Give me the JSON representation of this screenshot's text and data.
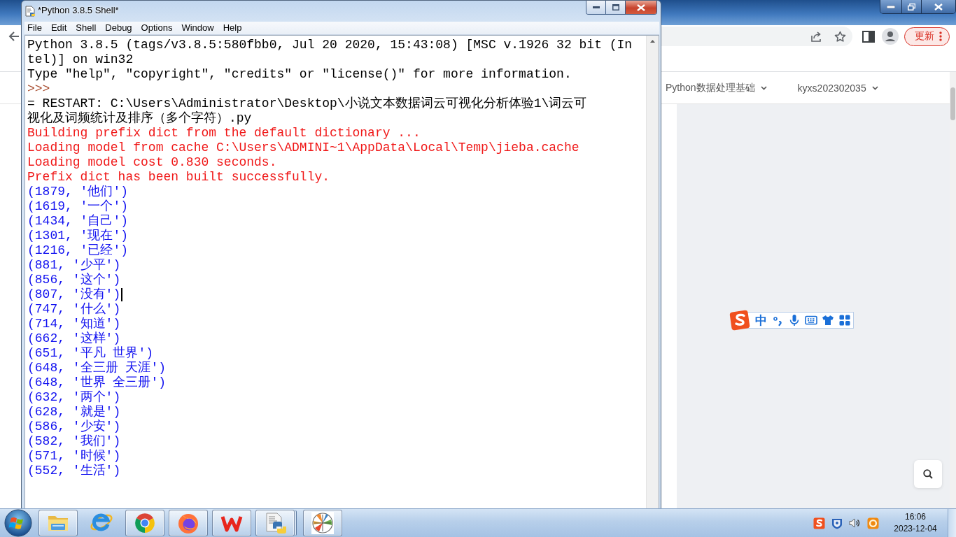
{
  "browser": {
    "update_button": "更新",
    "nav_items": [
      {
        "label": "Python数据处理基础"
      },
      {
        "label": "kyxs202302035"
      }
    ]
  },
  "shell_window": {
    "title": "*Python 3.8.5 Shell*",
    "menu": [
      "File",
      "Edit",
      "Shell",
      "Debug",
      "Options",
      "Window",
      "Help"
    ],
    "lines": [
      {
        "kind": "banner",
        "text": "Python 3.8.5 (tags/v3.8.5:580fbb0, Jul 20 2020, 15:43:08) [MSC v.1926 32 bit (In",
        "caret": false
      },
      {
        "kind": "banner",
        "text": "tel)] on win32",
        "caret": false
      },
      {
        "kind": "banner",
        "text": "Type \"help\", \"copyright\", \"credits\" or \"license()\" for more information.",
        "caret": false
      },
      {
        "kind": "prompt",
        "text": ">>>",
        "caret": false
      },
      {
        "kind": "restart",
        "text": "= RESTART: C:\\Users\\Administrator\\Desktop\\小说文本数据词云可视化分析体验1\\词云可",
        "caret": false
      },
      {
        "kind": "restart",
        "text": "视化及词频统计及排序（多个字符）.py",
        "caret": false
      },
      {
        "kind": "stderr",
        "text": "Building prefix dict from the default dictionary ...",
        "caret": false
      },
      {
        "kind": "stderr",
        "text": "Loading model from cache C:\\Users\\ADMINI~1\\AppData\\Local\\Temp\\jieba.cache",
        "caret": false
      },
      {
        "kind": "stderr",
        "text": "Loading model cost 0.830 seconds.",
        "caret": false
      },
      {
        "kind": "stderr",
        "text": "Prefix dict has been built successfully.",
        "caret": false
      },
      {
        "kind": "stdout",
        "text": "(1879, '他们')",
        "caret": false
      },
      {
        "kind": "stdout",
        "text": "(1619, '一个')",
        "caret": false
      },
      {
        "kind": "stdout",
        "text": "(1434, '自己')",
        "caret": false
      },
      {
        "kind": "stdout",
        "text": "(1301, '现在')",
        "caret": false
      },
      {
        "kind": "stdout",
        "text": "(1216, '已经')",
        "caret": false
      },
      {
        "kind": "stdout",
        "text": "(881, '少平')",
        "caret": false
      },
      {
        "kind": "stdout",
        "text": "(856, '这个')",
        "caret": false
      },
      {
        "kind": "stdout",
        "text": "(807, '没有')",
        "caret": true
      },
      {
        "kind": "stdout",
        "text": "(747, '什么')",
        "caret": false
      },
      {
        "kind": "stdout",
        "text": "(714, '知道')",
        "caret": false
      },
      {
        "kind": "stdout",
        "text": "(662, '这样')",
        "caret": false
      },
      {
        "kind": "stdout",
        "text": "(651, '平凡 世界')",
        "caret": false
      },
      {
        "kind": "stdout",
        "text": "(648, '全三册 天涯')",
        "caret": false
      },
      {
        "kind": "stdout",
        "text": "(648, '世界 全三册')",
        "caret": false
      },
      {
        "kind": "stdout",
        "text": "(632, '两个')",
        "caret": false
      },
      {
        "kind": "stdout",
        "text": "(628, '就是')",
        "caret": false
      },
      {
        "kind": "stdout",
        "text": "(586, '少安')",
        "caret": false
      },
      {
        "kind": "stdout",
        "text": "(582, '我们')",
        "caret": false
      },
      {
        "kind": "stdout",
        "text": "(571, '时候')",
        "caret": false
      },
      {
        "kind": "stdout",
        "text": "(552, '生活')",
        "caret": false
      }
    ]
  },
  "ime_toolbar": {
    "mode": "中"
  },
  "taskbar": {
    "apps": [
      {
        "kind": "file_manager",
        "running": true,
        "stacked": false
      },
      {
        "kind": "browser_e",
        "running": false,
        "stacked": false
      },
      {
        "kind": "browser_round",
        "running": true,
        "stacked": false
      },
      {
        "kind": "browser_fox",
        "running": true,
        "stacked": false
      },
      {
        "kind": "office",
        "running": true,
        "stacked": false
      },
      {
        "kind": "python",
        "running": true,
        "stacked": true
      },
      {
        "kind": "polar_plot",
        "running": true,
        "stacked": false
      }
    ],
    "clock": {
      "time": "16:06",
      "date": "2023-12-04"
    }
  }
}
